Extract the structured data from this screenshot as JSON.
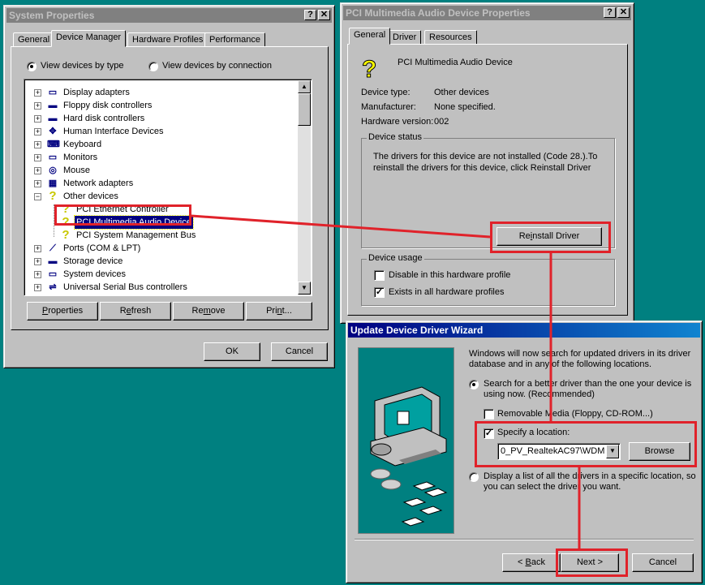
{
  "system_properties": {
    "title": "System Properties",
    "tabs": [
      "General",
      "Device Manager",
      "Hardware Profiles",
      "Performance"
    ],
    "view_by_type": "View devices by type",
    "view_by_connection": "View devices by connection",
    "tree": [
      {
        "label": "Display adapters",
        "icon": "display-icon"
      },
      {
        "label": "Floppy disk controllers",
        "icon": "floppy-icon"
      },
      {
        "label": "Hard disk controllers",
        "icon": "disk-icon"
      },
      {
        "label": "Human Interface Devices",
        "icon": "hid-icon"
      },
      {
        "label": "Keyboard",
        "icon": "keyboard-icon"
      },
      {
        "label": "Monitors",
        "icon": "monitor-icon"
      },
      {
        "label": "Mouse",
        "icon": "mouse-icon"
      },
      {
        "label": "Network adapters",
        "icon": "network-icon"
      },
      {
        "label": "Other devices",
        "icon": "question-icon"
      },
      {
        "label": "PCI Ethernet Controller",
        "icon": "question-icon"
      },
      {
        "label": "PCI Multimedia Audio Device",
        "icon": "question-icon"
      },
      {
        "label": "PCI System Management Bus",
        "icon": "question-icon"
      },
      {
        "label": "Ports (COM & LPT)",
        "icon": "port-icon"
      },
      {
        "label": "Storage device",
        "icon": "storage-icon"
      },
      {
        "label": "System devices",
        "icon": "system-icon"
      },
      {
        "label": "Universal Serial Bus controllers",
        "icon": "usb-icon"
      }
    ],
    "buttons": {
      "properties": "Properties",
      "refresh": "Refresh",
      "remove": "Remove",
      "print": "Print...",
      "ok": "OK",
      "cancel": "Cancel"
    }
  },
  "device_properties": {
    "title": "PCI Multimedia Audio Device Properties",
    "tabs": [
      "General",
      "Driver",
      "Resources"
    ],
    "device_name": "PCI Multimedia Audio Device",
    "device_type_label": "Device type:",
    "device_type_value": "Other devices",
    "manufacturer_label": "Manufacturer:",
    "manufacturer_value": "None specified.",
    "hardware_version_label": "Hardware version:",
    "hardware_version_value": "002",
    "status_group": "Device status",
    "status_line1": "The drivers for this device are not installed  (Code 28.).To",
    "status_line2": "reinstall the drivers for this device, click Reinstall Driver",
    "reinstall_button": "Reinstall Driver",
    "usage_group": "Device usage",
    "disable_label": "Disable in this hardware profile",
    "exists_label": "Exists in all hardware profiles"
  },
  "wizard": {
    "title": "Update Device Driver Wizard",
    "intro_line1": "Windows will now search for updated drivers in its driver",
    "intro_line2": "database and in any of the following locations.",
    "search_line1": "Search for a better driver than the one your device is",
    "search_line2": "using now. (Recommended)",
    "removable_label": "Removable Media (Floppy, CD-ROM...)",
    "specify_label": "Specify a location:",
    "location_value": "0_PV_RealtekAC97\\WDM",
    "browse_button": "Browse",
    "display_line1": "Display a list of all the drivers in a specific location, so",
    "display_line2": "you can select the driver you want.",
    "back_button": "< Back",
    "next_button": "Next >",
    "cancel_button": "Cancel"
  },
  "colors": {
    "highlight": "#e0222a",
    "desktop": "#008080",
    "selection": "#000080"
  }
}
